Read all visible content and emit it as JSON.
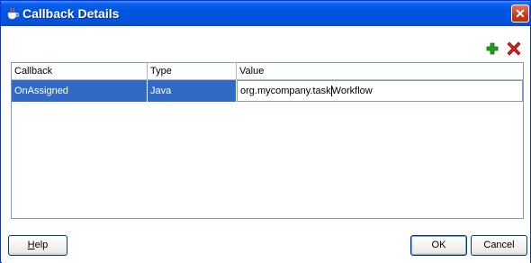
{
  "window": {
    "title": "Callback Details",
    "close_label": "✕"
  },
  "toolbar": {
    "add_icon": "plus-icon",
    "delete_icon": "delete-x-icon"
  },
  "table": {
    "columns": [
      "Callback",
      "Type",
      "Value"
    ],
    "rows": [
      {
        "callback": "OnAssigned",
        "type": "Java",
        "value_before_caret": "org.mycompany.task",
        "value_after_caret": "Workflow"
      }
    ]
  },
  "buttons": {
    "help_mnemonic": "H",
    "help_rest": "elp",
    "ok": "OK",
    "cancel": "Cancel"
  },
  "colors": {
    "selection": "#316ac5",
    "titlebar": "#0054e3",
    "add": "#1e9e1e",
    "delete": "#d21f1f"
  }
}
